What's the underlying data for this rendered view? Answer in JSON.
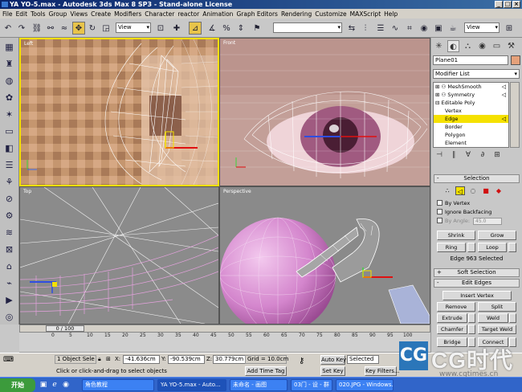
{
  "window": {
    "title": "YA YO-5.max - Autodesk 3ds Max 8 SP3 - Stand-alone License",
    "controls": [
      "_",
      "□",
      "×"
    ]
  },
  "menu": [
    "File",
    "Edit",
    "Tools",
    "Group",
    "Views",
    "Create",
    "Modifiers",
    "Character",
    "reactor",
    "Animation",
    "Graph Editors",
    "Rendering",
    "Customize",
    "MAXScript",
    "Help"
  ],
  "toolbar": {
    "ref_coord": "View",
    "named_selection": "",
    "view_combo": "View"
  },
  "viewports": {
    "top_left": "Left",
    "top_right": "Front",
    "bottom_left": "Top",
    "bottom_right": "Perspective"
  },
  "command_panel": {
    "object_name": "Plane01",
    "object_color": "#e5a17a",
    "modifier_list": "Modifier List",
    "stack": [
      {
        "label": "MeshSmooth",
        "bulb": true
      },
      {
        "label": "Symmetry",
        "bulb": true
      },
      {
        "label": "Editable Poly",
        "bulb": false
      },
      {
        "label": "Vertex",
        "bulb": false
      },
      {
        "label": "Edge",
        "bulb": false,
        "selected": true
      },
      {
        "label": "Border",
        "bulb": false
      },
      {
        "label": "Polygon",
        "bulb": false
      },
      {
        "label": "Element",
        "bulb": false
      }
    ],
    "selection": {
      "header": "Selection",
      "by_vertex": "By Vertex",
      "ignore_backfacing": "Ignore Backfacing",
      "by_angle": "By Angle:",
      "angle_value": "45.0",
      "shrink": "Shrink",
      "grow": "Grow",
      "ring": "Ring",
      "loop": "Loop",
      "info": "Edge 963 Selected"
    },
    "soft_selection": "Soft Selection",
    "edit_edges": {
      "header": "Edit Edges",
      "insert_vertex": "Insert Vertex",
      "remove": "Remove",
      "split": "Split",
      "extrude": "Extrude",
      "weld": "Weld",
      "chamfer": "Chamfer",
      "target_weld": "Target Weld",
      "bridge": "Bridge",
      "connect": "Connect"
    }
  },
  "timeline": {
    "frame": "0 / 100",
    "ticks": [
      "0",
      "5",
      "10",
      "15",
      "20",
      "25",
      "30",
      "35",
      "40",
      "45",
      "50",
      "55",
      "60",
      "65",
      "70",
      "75",
      "80",
      "85",
      "90",
      "95",
      "100"
    ]
  },
  "status": {
    "selected": "1 Object Sele",
    "x": "-41.636cm",
    "y": "-90.539cm",
    "z": "30.779cm",
    "grid": "Grid = 10.0cm",
    "auto_key": "Auto Key",
    "set_key": "Set Key",
    "key_mode": "Selected",
    "key_filters": "Key Filters...",
    "add_time_tag": "Add Time Tag",
    "prompt": "Click or click-and-drag to select objects"
  },
  "taskbar": {
    "start": "开始",
    "tasks": [
      "角色教程",
      "YA YO-5.max - Auto...",
      "未命名 - 画图",
      "03门 - 设 - 群",
      "020.JPG - Windows..."
    ]
  },
  "watermark": {
    "mark": "CG",
    "text": "CG时代",
    "url": "www.cgtimes.cn"
  }
}
